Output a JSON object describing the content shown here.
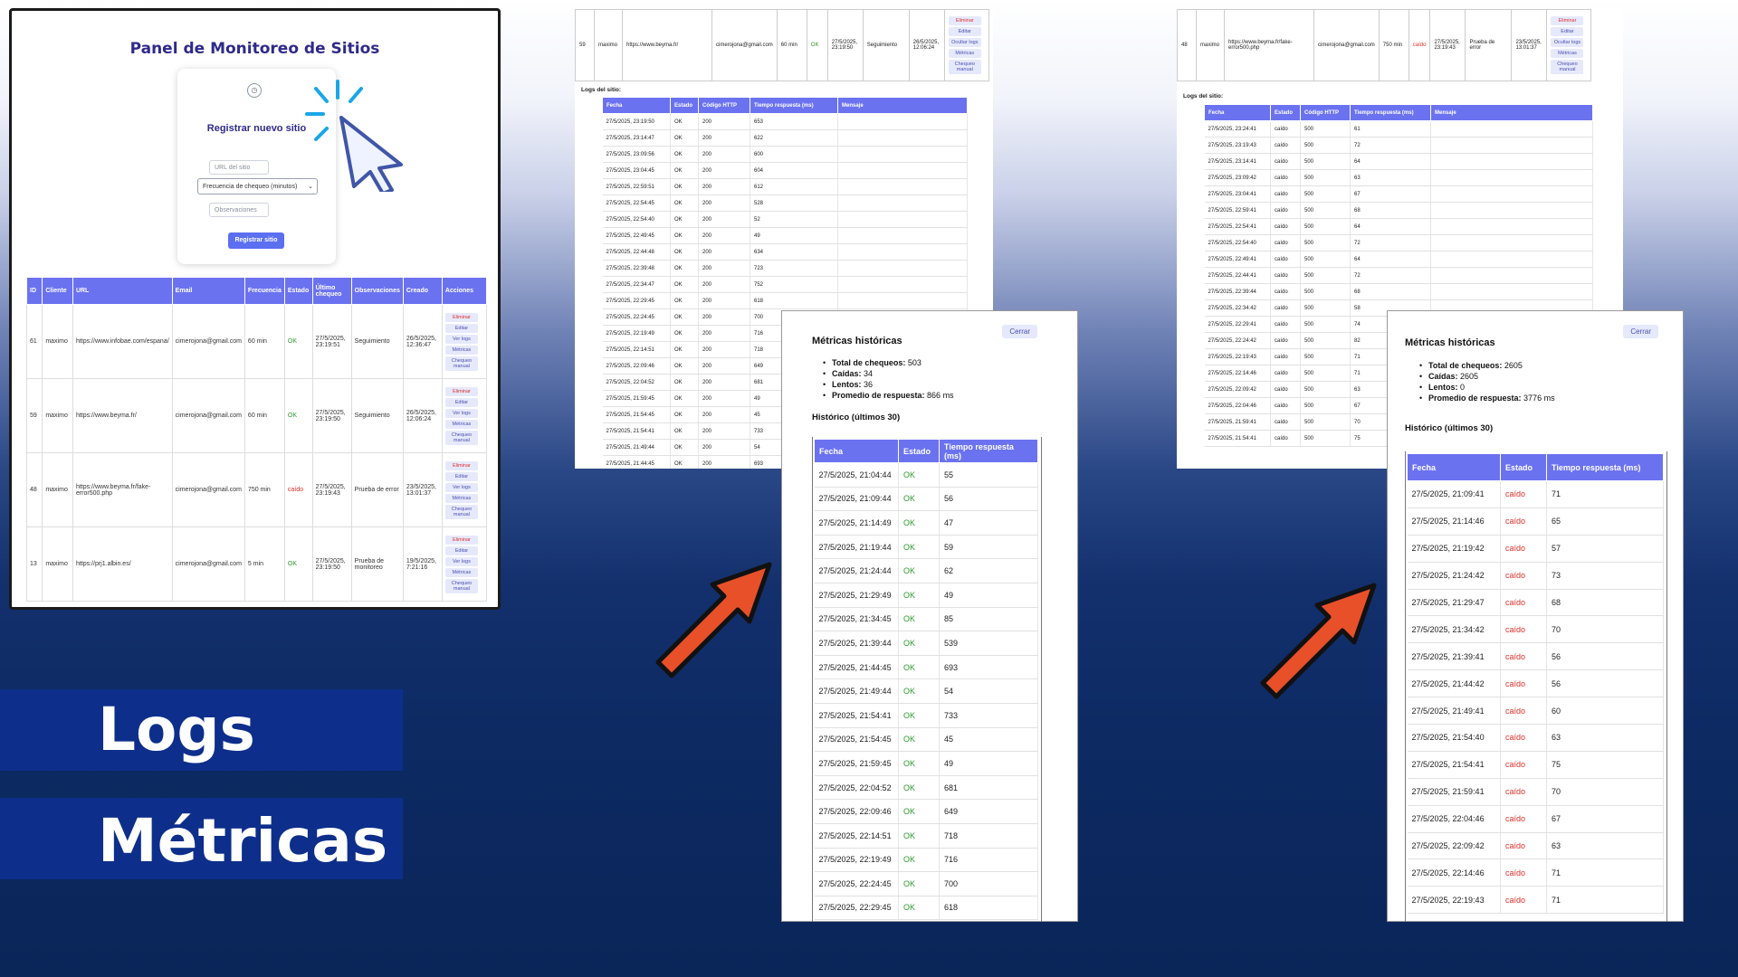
{
  "dashboard": {
    "title": "Panel de Monitoreo de Sitios",
    "form": {
      "title": "Registrar nuevo sitio",
      "url_placeholder": "URL del sitio",
      "freq_select": "Frecuencia de chequeo (minutos)",
      "obs_placeholder": "Observaciones",
      "submit": "Registrar sitio"
    },
    "columns": [
      "ID",
      "Cliente",
      "URL",
      "Email",
      "Frecuencia",
      "Estado",
      "Último chequeo",
      "Observaciones",
      "Creado",
      "Acciones"
    ],
    "rows": [
      {
        "id": "61",
        "cliente": "maximo",
        "url": "https://www.infobae.com/espana/",
        "email": "cimerojona@gmail.com",
        "freq": "60 min",
        "estado": "OK",
        "ultimo": "27/5/2025, 23:19:51",
        "obs": "Seguimiento",
        "creado": "26/5/2025, 12:36:47"
      },
      {
        "id": "59",
        "cliente": "maximo",
        "url": "https://www.beyma.fr/",
        "email": "cimerojona@gmail.com",
        "freq": "60 min",
        "estado": "OK",
        "ultimo": "27/5/2025, 23:19:50",
        "obs": "Seguimiento",
        "creado": "26/5/2025, 12:06:24"
      },
      {
        "id": "48",
        "cliente": "maximo",
        "url": "https://www.beyma.fr/fake-error500.php",
        "email": "cimerojona@gmail.com",
        "freq": "750 min",
        "estado": "caído",
        "ultimo": "27/5/2025, 23:19:43",
        "obs": "Prueba de error",
        "creado": "23/5/2025, 13:01:37"
      },
      {
        "id": "13",
        "cliente": "maximo",
        "url": "https://prj1.albin.es/",
        "email": "cimerojona@gmail.com",
        "freq": "5 min",
        "estado": "OK",
        "ultimo": "27/5/2025, 23:19:50",
        "obs": "Prueba de monitoreo",
        "creado": "19/5/2025, 7:21:16"
      }
    ],
    "actions": [
      "Eliminar",
      "Editar",
      "Ver logs",
      "Métricas",
      "Chequeo manual"
    ]
  },
  "logs_left": {
    "site_row": {
      "id": "59",
      "cliente": "maximo",
      "url": "https://www.beyma.fr/",
      "email": "cimerojona@gmail.com",
      "freq": "60 min",
      "estado": "OK",
      "ultimo": "27/5/2025, 23:19:50",
      "obs": "Seguimiento",
      "creado": "26/5/2025, 12:06:24"
    },
    "actions": [
      "Eliminar",
      "Editar",
      "Ocultar logs",
      "Métricas",
      "Chequeo manual"
    ],
    "label": "Logs del sitio:",
    "columns": [
      "Fecha",
      "Estado",
      "Código HTTP",
      "Tiempo respuesta (ms)",
      "Mensaje"
    ],
    "rows": [
      [
        "27/5/2025, 23:19:50",
        "OK",
        "200",
        "653",
        ""
      ],
      [
        "27/5/2025, 23:14:47",
        "OK",
        "200",
        "622",
        ""
      ],
      [
        "27/5/2025, 23:09:56",
        "OK",
        "200",
        "600",
        ""
      ],
      [
        "27/5/2025, 23:04:45",
        "OK",
        "200",
        "604",
        ""
      ],
      [
        "27/5/2025, 22:59:51",
        "OK",
        "200",
        "612",
        ""
      ],
      [
        "27/5/2025, 22:54:45",
        "OK",
        "200",
        "528",
        ""
      ],
      [
        "27/5/2025, 22:54:40",
        "OK",
        "200",
        "52",
        ""
      ],
      [
        "27/5/2025, 22:49:45",
        "OK",
        "200",
        "49",
        ""
      ],
      [
        "27/5/2025, 22:44:48",
        "OK",
        "200",
        "634",
        ""
      ],
      [
        "27/5/2025, 22:39:48",
        "OK",
        "200",
        "723",
        ""
      ],
      [
        "27/5/2025, 22:34:47",
        "OK",
        "200",
        "752",
        ""
      ],
      [
        "27/5/2025, 22:29:45",
        "OK",
        "200",
        "618",
        ""
      ],
      [
        "27/5/2025, 22:24:45",
        "OK",
        "200",
        "700",
        ""
      ],
      [
        "27/5/2025, 22:19:49",
        "OK",
        "200",
        "716",
        ""
      ],
      [
        "27/5/2025, 22:14:51",
        "OK",
        "200",
        "718",
        ""
      ],
      [
        "27/5/2025, 22:09:46",
        "OK",
        "200",
        "649",
        ""
      ],
      [
        "27/5/2025, 22:04:52",
        "OK",
        "200",
        "681",
        ""
      ],
      [
        "27/5/2025, 21:59:45",
        "OK",
        "200",
        "49",
        ""
      ],
      [
        "27/5/2025, 21:54:45",
        "OK",
        "200",
        "45",
        ""
      ],
      [
        "27/5/2025, 21:54:41",
        "OK",
        "200",
        "733",
        ""
      ],
      [
        "27/5/2025, 21:49:44",
        "OK",
        "200",
        "54",
        ""
      ],
      [
        "27/5/2025, 21:44:45",
        "OK",
        "200",
        "693",
        ""
      ]
    ]
  },
  "logs_right": {
    "site_row": {
      "id": "48",
      "cliente": "maximo",
      "url": "https://www.beyma.fr/fake-error500.php",
      "email": "cimerojona@gmail.com",
      "freq": "750 min",
      "estado": "caído",
      "ultimo": "27/5/2025, 23:19:43",
      "obs": "Prueba de error",
      "creado": "23/5/2025, 13:01:37"
    },
    "actions": [
      "Eliminar",
      "Editar",
      "Ocultar logs",
      "Métricas",
      "Chequeo manual"
    ],
    "label": "Logs del sitio:",
    "columns": [
      "Fecha",
      "Estado",
      "Código HTTP",
      "Tiempo respuesta (ms)",
      "Mensaje"
    ],
    "rows": [
      [
        "27/5/2025, 23:24:41",
        "caído",
        "500",
        "61",
        ""
      ],
      [
        "27/5/2025, 23:19:43",
        "caído",
        "500",
        "72",
        ""
      ],
      [
        "27/5/2025, 23:14:41",
        "caído",
        "500",
        "64",
        ""
      ],
      [
        "27/5/2025, 23:09:42",
        "caído",
        "500",
        "63",
        ""
      ],
      [
        "27/5/2025, 23:04:41",
        "caído",
        "500",
        "67",
        ""
      ],
      [
        "27/5/2025, 22:59:41",
        "caído",
        "500",
        "68",
        ""
      ],
      [
        "27/5/2025, 22:54:41",
        "caído",
        "500",
        "64",
        ""
      ],
      [
        "27/5/2025, 22:54:40",
        "caído",
        "500",
        "72",
        ""
      ],
      [
        "27/5/2025, 22:49:41",
        "caído",
        "500",
        "64",
        ""
      ],
      [
        "27/5/2025, 22:44:41",
        "caído",
        "500",
        "72",
        ""
      ],
      [
        "27/5/2025, 22:39:44",
        "caído",
        "500",
        "68",
        ""
      ],
      [
        "27/5/2025, 22:34:42",
        "caído",
        "500",
        "58",
        ""
      ],
      [
        "27/5/2025, 22:29:41",
        "caído",
        "500",
        "74",
        ""
      ],
      [
        "27/5/2025, 22:24:42",
        "caído",
        "500",
        "82",
        ""
      ],
      [
        "27/5/2025, 22:19:43",
        "caído",
        "500",
        "71",
        ""
      ],
      [
        "27/5/2025, 22:14:46",
        "caído",
        "500",
        "71",
        ""
      ],
      [
        "27/5/2025, 22:09:42",
        "caído",
        "500",
        "63",
        ""
      ],
      [
        "27/5/2025, 22:04:46",
        "caído",
        "500",
        "67",
        ""
      ],
      [
        "27/5/2025, 21:59:41",
        "caído",
        "500",
        "70",
        ""
      ],
      [
        "27/5/2025, 21:54:41",
        "caído",
        "500",
        "75",
        ""
      ]
    ]
  },
  "metrics_left": {
    "title": "Métricas históricas",
    "close": "Cerrar",
    "stats": [
      {
        "label": "Total de chequeos:",
        "value": "503"
      },
      {
        "label": "Caídas:",
        "value": "34"
      },
      {
        "label": "Lentos:",
        "value": "36"
      },
      {
        "label": "Promedio de respuesta:",
        "value": "866 ms"
      }
    ],
    "hist_title": "Histórico (últimos 30)",
    "columns": [
      "Fecha",
      "Estado",
      "Tiempo respuesta (ms)"
    ],
    "rows": [
      [
        "27/5/2025, 21:04:44",
        "OK",
        "55"
      ],
      [
        "27/5/2025, 21:09:44",
        "OK",
        "56"
      ],
      [
        "27/5/2025, 21:14:49",
        "OK",
        "47"
      ],
      [
        "27/5/2025, 21:19:44",
        "OK",
        "59"
      ],
      [
        "27/5/2025, 21:24:44",
        "OK",
        "62"
      ],
      [
        "27/5/2025, 21:29:49",
        "OK",
        "49"
      ],
      [
        "27/5/2025, 21:34:45",
        "OK",
        "85"
      ],
      [
        "27/5/2025, 21:39:44",
        "OK",
        "539"
      ],
      [
        "27/5/2025, 21:44:45",
        "OK",
        "693"
      ],
      [
        "27/5/2025, 21:49:44",
        "OK",
        "54"
      ],
      [
        "27/5/2025, 21:54:41",
        "OK",
        "733"
      ],
      [
        "27/5/2025, 21:54:45",
        "OK",
        "45"
      ],
      [
        "27/5/2025, 21:59:45",
        "OK",
        "49"
      ],
      [
        "27/5/2025, 22:04:52",
        "OK",
        "681"
      ],
      [
        "27/5/2025, 22:09:46",
        "OK",
        "649"
      ],
      [
        "27/5/2025, 22:14:51",
        "OK",
        "718"
      ],
      [
        "27/5/2025, 22:19:49",
        "OK",
        "716"
      ],
      [
        "27/5/2025, 22:24:45",
        "OK",
        "700"
      ],
      [
        "27/5/2025, 22:29:45",
        "OK",
        "618"
      ]
    ]
  },
  "metrics_right": {
    "title": "Métricas históricas",
    "close": "Cerrar",
    "stats": [
      {
        "label": "Total de chequeos:",
        "value": "2605"
      },
      {
        "label": "Caídas:",
        "value": "2605"
      },
      {
        "label": "Lentos:",
        "value": "0"
      },
      {
        "label": "Promedio de respuesta:",
        "value": "3776 ms"
      }
    ],
    "hist_title": "Histórico (últimos 30)",
    "columns": [
      "Fecha",
      "Estado",
      "Tiempo respuesta (ms)"
    ],
    "rows": [
      [
        "27/5/2025, 21:09:41",
        "caído",
        "71"
      ],
      [
        "27/5/2025, 21:14:46",
        "caído",
        "65"
      ],
      [
        "27/5/2025, 21:19:42",
        "caído",
        "57"
      ],
      [
        "27/5/2025, 21:24:42",
        "caído",
        "73"
      ],
      [
        "27/5/2025, 21:29:47",
        "caído",
        "68"
      ],
      [
        "27/5/2025, 21:34:42",
        "caído",
        "70"
      ],
      [
        "27/5/2025, 21:39:41",
        "caído",
        "56"
      ],
      [
        "27/5/2025, 21:44:42",
        "caído",
        "56"
      ],
      [
        "27/5/2025, 21:49:41",
        "caído",
        "60"
      ],
      [
        "27/5/2025, 21:54:40",
        "caído",
        "63"
      ],
      [
        "27/5/2025, 21:54:41",
        "caído",
        "75"
      ],
      [
        "27/5/2025, 21:59:41",
        "caído",
        "70"
      ],
      [
        "27/5/2025, 22:04:46",
        "caído",
        "67"
      ],
      [
        "27/5/2025, 22:09:42",
        "caído",
        "63"
      ],
      [
        "27/5/2025, 22:14:46",
        "caído",
        "71"
      ],
      [
        "27/5/2025, 22:19:43",
        "caído",
        "71"
      ]
    ]
  },
  "captions": {
    "logs": "Logs",
    "metricas": "Métricas"
  },
  "colors": {
    "accent": "#6b72f0",
    "ok": "#2b9a2b",
    "down": "#e0302a",
    "arrow": "#e8502a",
    "caption_bg": "#0d2f8b"
  },
  "icons": [
    "clock-icon",
    "cursor-click-icon",
    "arrow-icon"
  ]
}
